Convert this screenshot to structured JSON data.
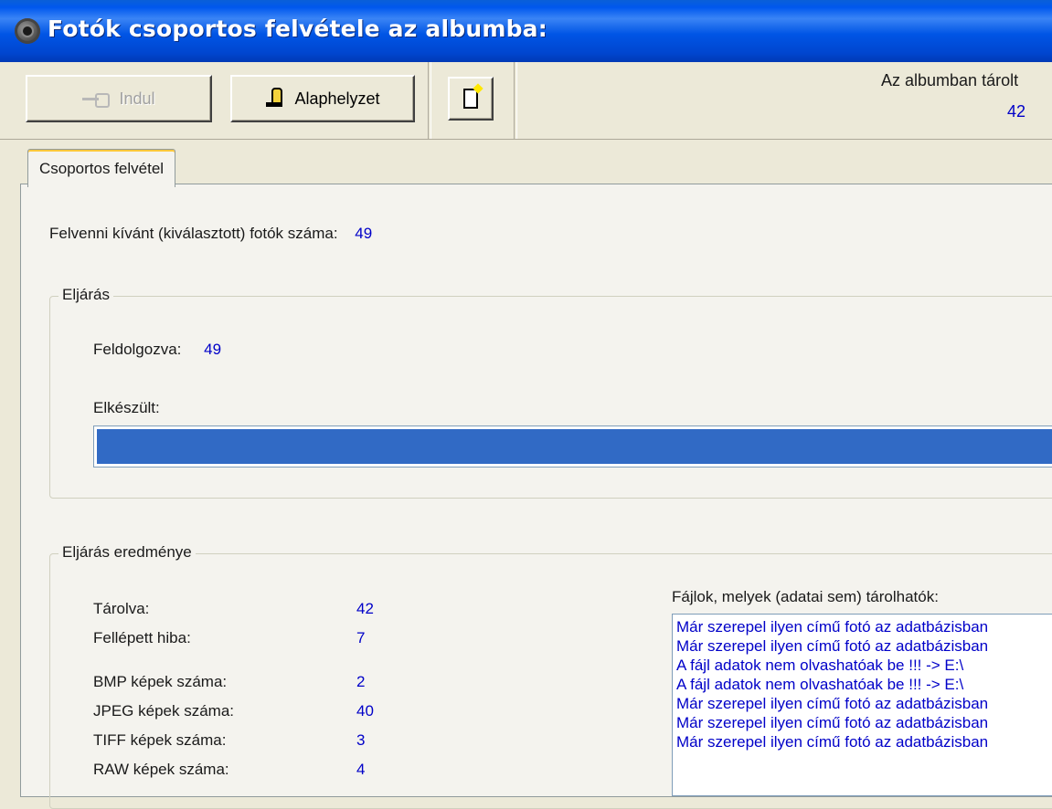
{
  "window": {
    "title": "Fotók csoportos felvétele az albumba:"
  },
  "toolbar": {
    "start_label": "Indul",
    "reset_label": "Alaphelyzet",
    "info_label": "Az albumban tárolt",
    "info_value": "42"
  },
  "tabs": [
    {
      "label": "Csoportos felvétel"
    }
  ],
  "selection": {
    "label": "Felvenni kívánt (kiválasztott) fotók száma:",
    "value": "49"
  },
  "process": {
    "title": "Eljárás",
    "processed_label": "Feldolgozva:",
    "processed_value": "49",
    "done_label": "Elkészült:",
    "progress_fraction": 1.0
  },
  "results": {
    "title": "Eljárás eredménye",
    "stats": [
      {
        "label": "Tárolva:",
        "value": "42"
      },
      {
        "label": "Fellépett hiba:",
        "value": "7"
      },
      {
        "label": "BMP képek száma:",
        "value": "2"
      },
      {
        "label": "JPEG képek száma:",
        "value": "40"
      },
      {
        "label": "TIFF képek száma:",
        "value": "3"
      },
      {
        "label": "RAW képek száma:",
        "value": "4"
      }
    ],
    "list_caption": "Fájlok, melyek (adatai sem) tárolhatók:",
    "list_items": [
      "Már szerepel ilyen című fotó az adatbázisban",
      "Már szerepel ilyen című fotó az adatbázisban",
      "A fájl adatok nem olvashatóak be !!! -> E:\\",
      "A fájl adatok nem olvashatóak be !!! -> E:\\",
      "Már szerepel ilyen című fotó az adatbázisban",
      "Már szerepel ilyen című fotó az adatbázisban",
      "Már szerepel ilyen című fotó az adatbázisban"
    ]
  },
  "colors": {
    "value_blue": "#0000c8",
    "progress": "#316ac5",
    "titlebar": "#0055e5"
  },
  "icons": [
    "app-icon",
    "hand-pointer-icon",
    "reset-hand-icon",
    "new-document-icon"
  ]
}
